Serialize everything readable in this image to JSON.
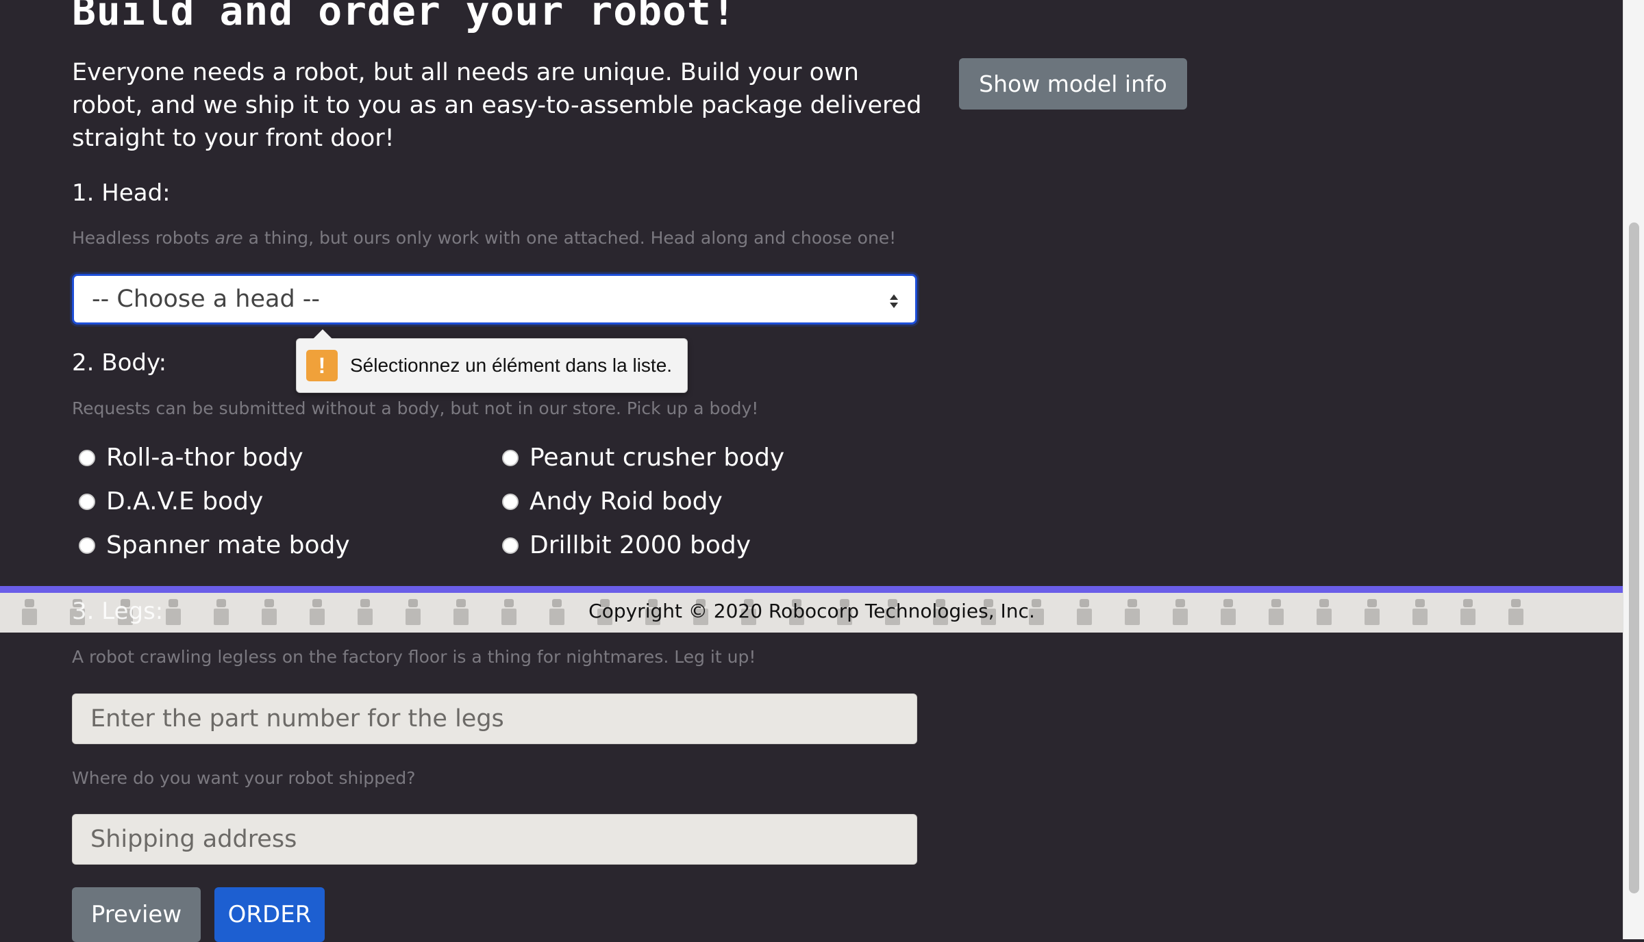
{
  "page": {
    "title": "Build and order your robot!",
    "intro": "Everyone needs a robot, but all needs are unique. Build your own robot, and we ship it to you as an easy-to-assemble package delivered straight to your front door!",
    "show_model_info_label": "Show model info"
  },
  "head": {
    "label": "1. Head:",
    "hint_before": "Headless robots ",
    "hint_em": "are",
    "hint_after": " a thing, but ours only work with one attached. Head along and choose one!",
    "select_value": "-- Choose a head --"
  },
  "tooltip": {
    "icon": "!",
    "message": "Sélectionnez un élément dans la liste."
  },
  "body": {
    "label": "2. Body:",
    "hint": "Requests can be submitted without a body, but not in our store. Pick up a body!",
    "options": [
      "Roll-a-thor body",
      "Peanut crusher body",
      "D.A.V.E body",
      "Andy Roid body",
      "Spanner mate body",
      "Drillbit 2000 body"
    ]
  },
  "legs": {
    "label": "3. Legs:",
    "hint": "A robot crawling legless on the factory floor is a thing for nightmares. Leg it up!",
    "placeholder": "Enter the part number for the legs"
  },
  "shipping": {
    "hint": "Where do you want your robot shipped?",
    "placeholder": "Shipping address"
  },
  "footer": {
    "copyright": "Copyright © 2020 Robocorp Technologies, Inc."
  },
  "actions": {
    "preview_label": "Preview",
    "order_label": "ORDER"
  },
  "colors": {
    "background": "#2a262e",
    "accent_bar": "#6a5ee8",
    "order_button": "#1d5fd1",
    "secondary_button": "#6c757d",
    "warning": "#f0a13a"
  }
}
